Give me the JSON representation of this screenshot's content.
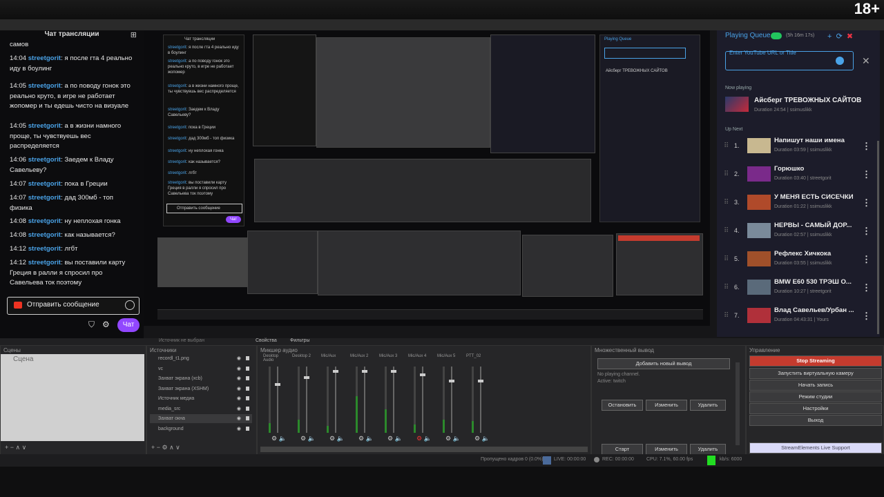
{
  "age_badge": "18+",
  "chat": {
    "header": "Чат трансляции",
    "top_fragment": "самов",
    "messages": [
      {
        "time": "14:04",
        "user": "streetgorit",
        "text": ": я после гта 4 реально иду в боулинг"
      },
      {
        "time": "14:05",
        "user": "streetgorit",
        "text": ": а по поводу гонок это реально круто, в игре не работает жопомер и ты едешь чисто на визуале"
      },
      {
        "time": "14:05",
        "user": "streetgorit",
        "text": ": а в жизни намного проще, ты чувствуешь вес распределяется"
      },
      {
        "time": "14:06",
        "user": "streetgorit",
        "text": ": Заедем к Владу Савельеву?"
      },
      {
        "time": "14:07",
        "user": "streetgorit",
        "text": ": пока в Греции"
      },
      {
        "time": "14:07",
        "user": "streetgorit",
        "text": ": дад 300мб - топ физика"
      },
      {
        "time": "14:08",
        "user": "streetgorit",
        "text": ": ну неплохая гонка"
      },
      {
        "time": "14:08",
        "user": "streetgorit",
        "text": ": как называется?"
      },
      {
        "time": "14:12",
        "user": "streetgorit",
        "text": ": лгбт"
      },
      {
        "time": "14:12",
        "user": "streetgorit",
        "text": ": вы поставили карту Греция в ралли я спросил про Савельева ток поэтому"
      }
    ],
    "input_placeholder": "Отправить сообщение",
    "send_button": "Чат"
  },
  "inner_chat": {
    "header": "Чат трансляции",
    "input_placeholder": "Отправить сообщение",
    "send_button": "Чат"
  },
  "queue": {
    "title": "Playing Queue",
    "time": "(5h 16m 17s)",
    "url_placeholder": "Enter YouTube URL or Title",
    "now_playing_label": "Now playing",
    "now_playing": {
      "title": "Айсберг ТРЕВОЖНЫХ САЙТОВ",
      "meta": "Duration 24:54 | ssimuslikk"
    },
    "up_next_label": "Up Next",
    "items": [
      {
        "num": "1.",
        "title": "Напишут наши имена",
        "meta": "Duration 03:59 | ssimuslikk",
        "thumb_color": "#c8b890"
      },
      {
        "num": "2.",
        "title": "Горюшко",
        "meta": "Duration 03:40 | streetgorit",
        "thumb_color": "#7a2a8a"
      },
      {
        "num": "3.",
        "title": "У МЕНЯ ЕСТЬ СИСЕЧКИ",
        "meta": "Duration 01:22 | ssimuslikk",
        "thumb_color": "#b04a2a"
      },
      {
        "num": "4.",
        "title": "НЕРВЫ - САМЫЙ ДОР...",
        "meta": "Duration 02:57 | ssimuslikk",
        "thumb_color": "#7a8a9a"
      },
      {
        "num": "5.",
        "title": "Рефлекс Хичкока",
        "meta": "Duration 03:55 | ssimuslikk",
        "thumb_color": "#a0502a"
      },
      {
        "num": "6.",
        "title": "BMW E60 530 ТРЭШ О...",
        "meta": "Duration 10:27 | streetgorit",
        "thumb_color": "#5a6a7a"
      },
      {
        "num": "7.",
        "title": "Влад Савельев/Урбан ...",
        "meta": "Duration 04:43:31 | Yours",
        "thumb_color": "#b0303a"
      }
    ]
  },
  "docks": {
    "scenes_title": "Сцены",
    "scene_item": "Сцена",
    "sources_title": "Источники",
    "sources": [
      "recordl_t1.png",
      "vc",
      "Захват экрана (xcb)",
      "Захват экрана (XSHM)",
      "Источник медиа",
      "media_src",
      "Захват окна",
      "background"
    ],
    "mixer_title": "Микшер аудио",
    "mixer_channels": [
      "Desktop Audio",
      "Desktop 2",
      "Mic/Aux",
      "Mic/Aux 2",
      "Mic/Aux 3",
      "Mic/Aux 4",
      "Mic/Aux 5",
      "PTT_02"
    ],
    "outputs_title": "Множественный вывод",
    "outputs": {
      "add_button": "Добавить новый вывод",
      "status": "No playing channel.",
      "target": "Active: twitch",
      "stop": "Остановить",
      "edit": "Изменить",
      "delete": "Удалить",
      "start": "Старт",
      "edit2": "Изменить",
      "delete2": "Удалить"
    },
    "controls_title": "Управление",
    "controls": [
      "Stop Streaming",
      "Запустить виртуальную камеру",
      "Начать запись",
      "Режим студии",
      "Настройки",
      "Выход"
    ],
    "plugin_link": "StreamElements Live Support"
  },
  "toolbar_strip": {
    "properties": "Свойства",
    "filters": "Фильтры",
    "no_source": "Источник не выбран"
  },
  "status": {
    "dropped": "Пропущено кадров 0 (0.0%)",
    "live": "LIVE: 00:00:00",
    "rec": "REC: 00:00:00",
    "cpu": "CPU: 7.1%, 60.00 fps",
    "kbps": "kb/s: 6000"
  }
}
